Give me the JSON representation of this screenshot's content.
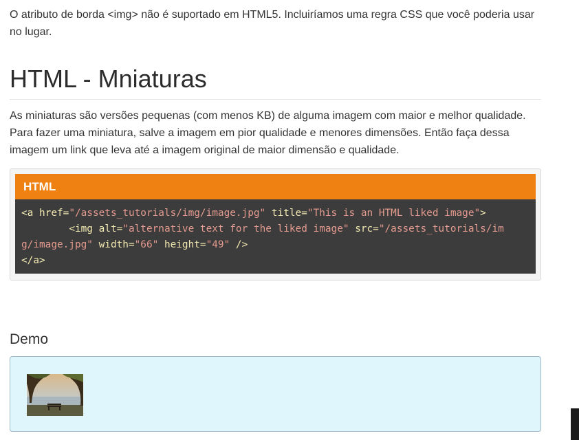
{
  "intro": {
    "text": "O atributo de borda <img> não é suportado em HTML5. Incluiríamos uma regra CSS que você poderia usar no lugar."
  },
  "section": {
    "title": "HTML - Mniaturas",
    "description": "As miniaturas são versões pequenas (com menos KB) de alguma imagem com maior e melhor qualidade. Para fazer uma miniatura, salve a imagem em pior qualidade e menores dimensões. Então faça dessa imagem um link que leva até a imagem original de maior dimensão e qualidade."
  },
  "code_block": {
    "language_label": "HTML",
    "line1": {
      "open_tag": "<a",
      "attr1": " href=",
      "val1": "\"/assets_tutorials/img/image.jpg\"",
      "attr2": " title=",
      "val2": "\"This is an HTML liked image\"",
      "close": ">"
    },
    "line2": {
      "indent": "        ",
      "open_tag": "<img",
      "attr1": " alt=",
      "val1": "\"alternative text for the liked image\"",
      "attr2": " src=",
      "val2a": "\"/assets_tutorials/im"
    },
    "line3": {
      "val2b": "g/image.jpg\"",
      "attr3": " width=",
      "val3": "\"66\"",
      "attr4": " height=",
      "val4": "\"49\"",
      "close": " />"
    },
    "line4": {
      "close_tag": "</a>"
    }
  },
  "demo": {
    "title": "Demo",
    "thumbnail_alt": "alternative text for the liked image",
    "thumbnail_title": "This is an HTML liked image",
    "thumbnail_href": "/assets_tutorials/img/image.jpg"
  },
  "colors": {
    "accent": "#ee8112",
    "code_bg": "#3c3c3c",
    "demo_bg": "#dff7fc"
  }
}
